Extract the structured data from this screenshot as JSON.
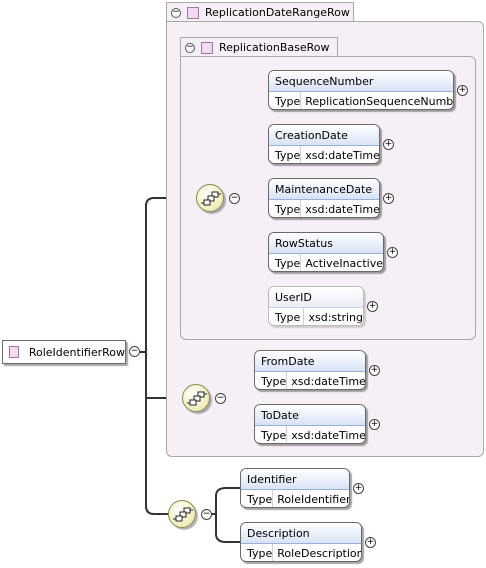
{
  "root": {
    "name": "RoleIdentifierRow"
  },
  "groups": {
    "outer": {
      "name": "ReplicationDateRangeRow"
    },
    "inner": {
      "name": "ReplicationBaseRow"
    }
  },
  "type_label": "Type",
  "elements": {
    "sequence_number": {
      "name": "SequenceNumber",
      "type": "ReplicationSequenceNumber"
    },
    "creation_date": {
      "name": "CreationDate",
      "type": "xsd:dateTime"
    },
    "maintenance_date": {
      "name": "MaintenanceDate",
      "type": "xsd:dateTime"
    },
    "row_status": {
      "name": "RowStatus",
      "type": "ActiveInactive"
    },
    "user_id": {
      "name": "UserID",
      "type": "xsd:string"
    },
    "from_date": {
      "name": "FromDate",
      "type": "xsd:dateTime"
    },
    "to_date": {
      "name": "ToDate",
      "type": "xsd:dateTime"
    },
    "identifier": {
      "name": "Identifier",
      "type": "RoleIdentifier"
    },
    "description": {
      "name": "Description",
      "type": "RoleDescription"
    }
  }
}
